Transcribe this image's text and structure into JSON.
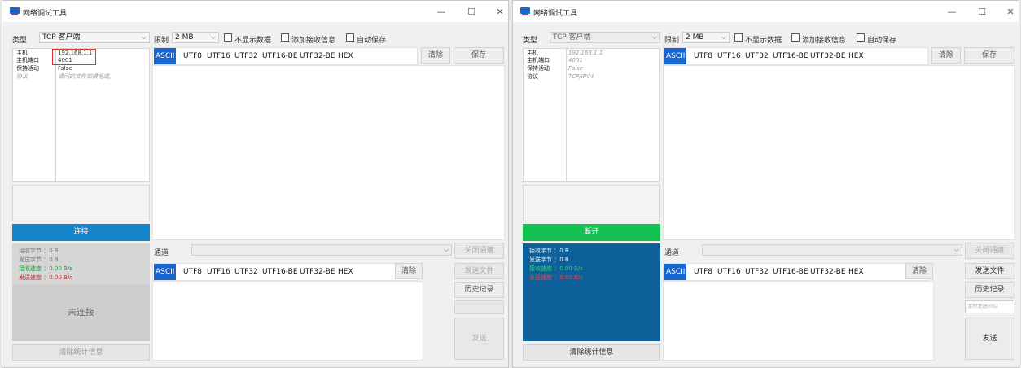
{
  "window_title": "网络调试工具",
  "controls": {
    "minimize": "—",
    "maximize": "☐",
    "close": "✕"
  },
  "type_label": "类型",
  "type_value": "TCP 客户端",
  "limit_label": "限制",
  "limit_value": "2 MB",
  "checkboxes": [
    "不显示数据",
    "添加接收信息",
    "自动保存"
  ],
  "props": {
    "host_label": "主机",
    "host_value": "192.168.1.1",
    "port_label": "主机端口",
    "port_value": "4001",
    "keepalive_label": "保持活动",
    "keepalive_value": "False",
    "protocol_label": "协议",
    "protocol_hint": "请问的文件如模毛或,",
    "protocol_value_right": "TCP/IPV4"
  },
  "connect_label": "连接",
  "disconnect_label": "断开",
  "stats": {
    "recv_bytes": "接收字节 ：0 B",
    "send_bytes": "发送字节 ：0 B",
    "recv_speed": "接收速度 ：0.00 B/s",
    "send_speed": "发送速度 ：0.00 B/s"
  },
  "not_connected": "未连接",
  "clear_stats": "清除统计信息",
  "encodings": [
    "ASCII",
    "UTF8",
    "UTF16",
    "UTF32",
    "UTF16-BE",
    "UTF32-BE",
    "HEX"
  ],
  "clear_label": "清除",
  "save_label": "保存",
  "channel_label": "通道",
  "close_channel": "关闭通道",
  "send_file": "发送文件",
  "history": "历史记录",
  "timer_placeholder": "定时发送(ms)",
  "send_label": "发送",
  "colors": {
    "accent": "#1a66d0",
    "connect": "#1483c9",
    "disconnect": "#13c152",
    "stats_bg": "#0e609b",
    "recv_speed": "#1a9c3c",
    "send_speed": "#d02a2a"
  }
}
